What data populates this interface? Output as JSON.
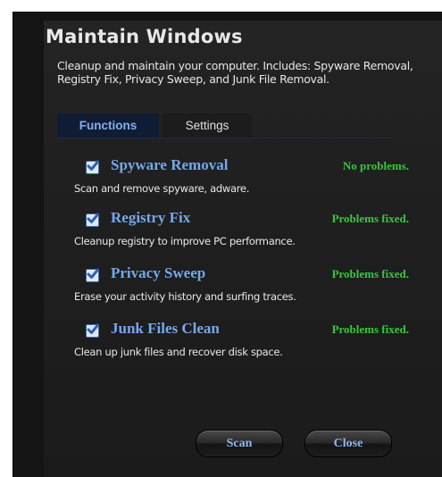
{
  "title": "Maintain Windows",
  "description": "Cleanup and maintain your computer. Includes: Spyware Removal, Registry Fix, Privacy Sweep, and Junk File Removal.",
  "tabs": [
    {
      "label": "Functions",
      "active": true
    },
    {
      "label": "Settings",
      "active": false
    }
  ],
  "items": [
    {
      "label": "Spyware Removal",
      "status": "No problems.",
      "description": "Scan and remove spyware, adware.",
      "checked": true
    },
    {
      "label": "Registry Fix",
      "status": "Problems fixed.",
      "description": "Cleanup registry to improve PC performance.",
      "checked": true
    },
    {
      "label": "Privacy Sweep",
      "status": "Problems fixed.",
      "description": "Erase your activity history and surfing traces.",
      "checked": true
    },
    {
      "label": "Junk Files Clean",
      "status": "Problems fixed.",
      "description": "Clean up junk files and recover disk space.",
      "checked": true
    }
  ],
  "buttons": {
    "scan_label": "Scan",
    "close_label": "Close"
  },
  "colors": {
    "accent": "#76a8ea",
    "status_ok": "#35c83a",
    "background": "#1f1f1f"
  }
}
